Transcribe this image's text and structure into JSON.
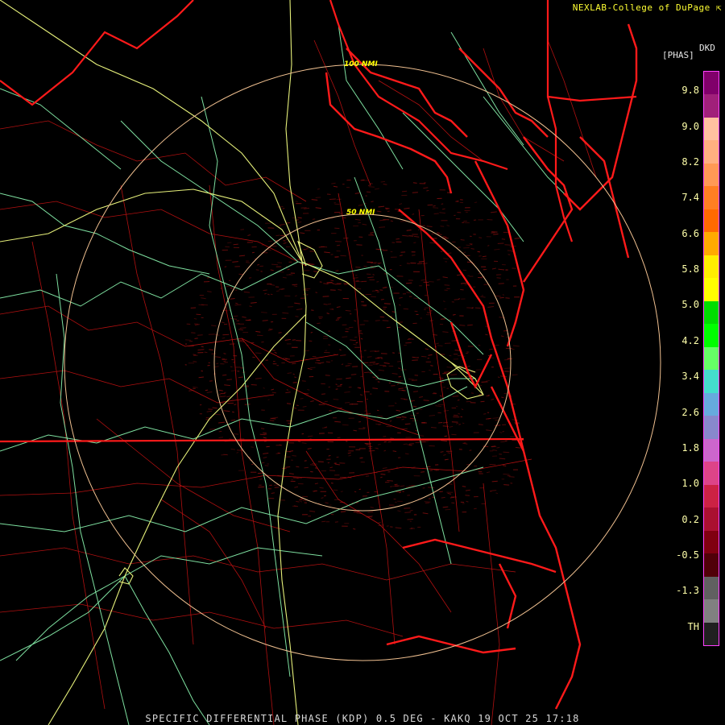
{
  "map": {
    "credit": "NEXLAB-College of DuPage",
    "credit_icon": "external-link-icon",
    "footer": "SPECIFIC DIFFERENTIAL PHASE (KDP) 0.5 DEG - KAKQ 19 OCT 25 17:18",
    "range_rings": [
      {
        "label": "100 NMI"
      },
      {
        "label": "50 NMI"
      }
    ],
    "colors": {
      "background": "#000000",
      "state_border": "#ff1a1a",
      "county_border": "#b01010",
      "highway": "#7ee0a0",
      "interstate": "#e6f07a",
      "range_ring": "#f0c090",
      "echo": "#8a1010"
    }
  },
  "legend": {
    "product": "DKD",
    "unit": "[PHAS]",
    "tick_labels": [
      "9.8",
      "9.0",
      "8.2",
      "7.4",
      "6.6",
      "5.8",
      "5.0",
      "4.2",
      "3.4",
      "2.6",
      "1.8",
      "1.0",
      "0.2",
      "-0.5",
      "-1.3",
      "TH"
    ],
    "swatches": [
      "#80006a",
      "#a0207a",
      "#ffc0a0",
      "#ffb080",
      "#ff9955",
      "#ff7f22",
      "#ff6a00",
      "#ffaa00",
      "#ffee00",
      "#ffff00",
      "#00dd00",
      "#00ff00",
      "#66ff66",
      "#44ddcc",
      "#66aadd",
      "#8888cc",
      "#cc66cc",
      "#dd4488",
      "#cc2244",
      "#aa1030",
      "#800010",
      "#500008",
      "#606060",
      "#808080",
      "#202020"
    ]
  }
}
